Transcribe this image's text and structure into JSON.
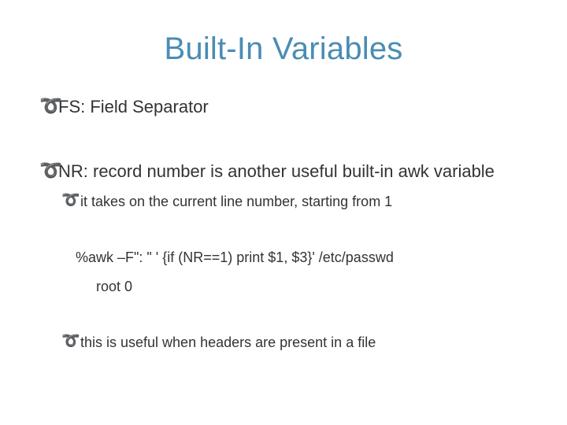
{
  "slide": {
    "title": "Built-In Variables",
    "items": [
      {
        "text": "FS: Field Separator"
      },
      {
        "text": "NR:  record number is another useful built-in awk variable"
      },
      {
        "text": "it takes on the current line number, starting from 1"
      },
      {
        "text": "%awk –F\": \"  ' {if (NR==1)  print $1, $3}'  /etc/passwd"
      },
      {
        "text": "root 0"
      },
      {
        "text": "this is useful when headers are present in a file"
      }
    ]
  },
  "bullet_glyph": "➰"
}
